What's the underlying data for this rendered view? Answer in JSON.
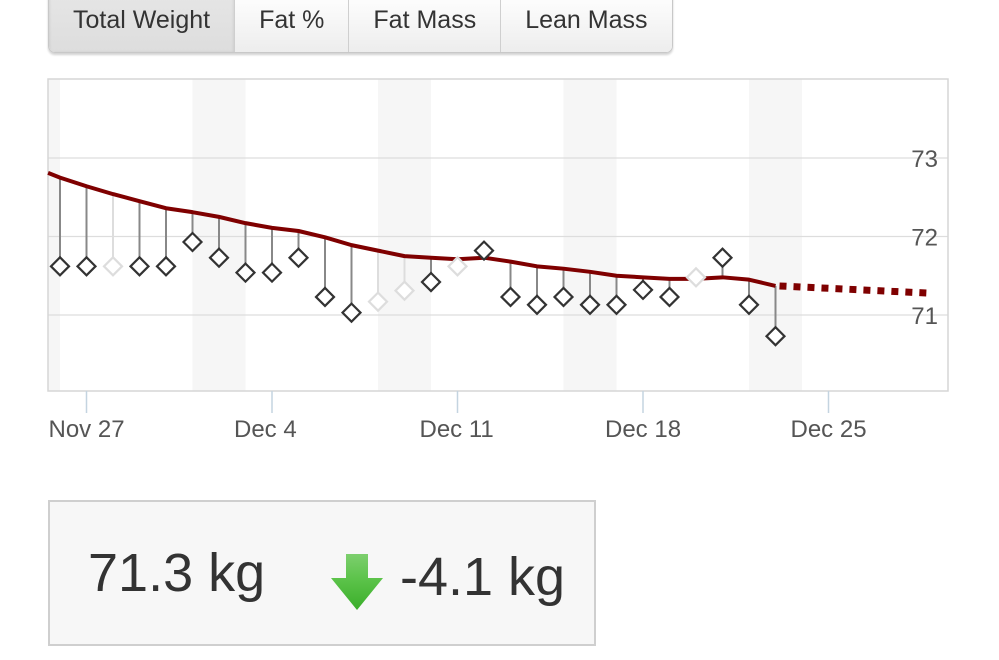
{
  "tabs": [
    {
      "label": "Total Weight",
      "active": true
    },
    {
      "label": "Fat %",
      "active": false
    },
    {
      "label": "Fat Mass",
      "active": false
    },
    {
      "label": "Lean Mass",
      "active": false
    }
  ],
  "summary": {
    "current_weight": "71.3 kg",
    "change_icon": "down-arrow-icon",
    "change": "-4.1 kg",
    "change_color": "#4cbb3a"
  },
  "colors": {
    "trend": "#7f0000",
    "stem": "#888888",
    "stem_faded": "#dddddd",
    "marker": "#333333",
    "marker_faded": "#dddddd",
    "grid": "#dddddd",
    "weekend_band": "#f6f6f6",
    "axis_text": "#555555"
  },
  "chart_data": {
    "type": "line",
    "title": "",
    "xlabel": "",
    "ylabel": "",
    "x_start": "Nov 25",
    "x_end": "Dec 29",
    "ylim": [
      70.0,
      74.0
    ],
    "y_ticks": [
      71,
      72,
      73
    ],
    "y_tick_labels": [
      "71",
      "72",
      "73"
    ],
    "y_axis_side": "right",
    "x_tick_days": [
      2,
      9,
      16,
      23,
      30
    ],
    "x_tick_labels": [
      "Nov 27",
      "Dec 4",
      "Dec 11",
      "Dec 18",
      "Dec 25"
    ],
    "weekend_bands_days": [
      [
        0,
        1
      ],
      [
        6,
        8
      ],
      [
        13,
        15
      ],
      [
        20,
        22
      ],
      [
        27,
        29
      ]
    ],
    "grid": true,
    "legend": "none",
    "series": [
      {
        "name": "Weight",
        "style": "diamond-markers-with-stems",
        "days": [
          1,
          2,
          3,
          4,
          5,
          6,
          7,
          8,
          9,
          10,
          11,
          12,
          13,
          14,
          15,
          16,
          17,
          18,
          19,
          20,
          21,
          22,
          23,
          24,
          25,
          26,
          27,
          28
        ],
        "dates": [
          "Nov 26",
          "Nov 27",
          "Nov 28",
          "Nov 29",
          "Nov 30",
          "Dec 1",
          "Dec 2",
          "Dec 3",
          "Dec 4",
          "Dec 5",
          "Dec 6",
          "Dec 7",
          "Dec 8",
          "Dec 9",
          "Dec 10",
          "Dec 11",
          "Dec 12",
          "Dec 13",
          "Dec 14",
          "Dec 15",
          "Dec 16",
          "Dec 17",
          "Dec 18",
          "Dec 19",
          "Dec 20",
          "Dec 21",
          "Dec 22",
          "Dec 23"
        ],
        "values": [
          71.62,
          71.62,
          71.62,
          71.62,
          71.62,
          71.93,
          71.73,
          71.54,
          71.54,
          71.73,
          71.23,
          71.03,
          71.17,
          71.31,
          71.42,
          71.62,
          71.82,
          71.23,
          71.13,
          71.23,
          71.13,
          71.13,
          71.32,
          71.23,
          71.48,
          71.73,
          71.13,
          70.73
        ],
        "faded": [
          false,
          false,
          true,
          false,
          false,
          false,
          false,
          false,
          false,
          false,
          false,
          false,
          true,
          true,
          false,
          true,
          false,
          false,
          false,
          false,
          false,
          false,
          false,
          false,
          true,
          false,
          false,
          false
        ]
      },
      {
        "name": "Trend",
        "style": "solid",
        "days": [
          0.55,
          1,
          2,
          3,
          4,
          5,
          6,
          7,
          8,
          9,
          10,
          11,
          12,
          13,
          14,
          15,
          16,
          17,
          18,
          19,
          20,
          21,
          22,
          23,
          24,
          25,
          26,
          27,
          28
        ],
        "values": [
          72.81,
          72.75,
          72.64,
          72.54,
          72.45,
          72.36,
          72.31,
          72.25,
          72.17,
          72.11,
          72.07,
          71.99,
          71.89,
          71.82,
          71.75,
          71.73,
          71.71,
          71.73,
          71.68,
          71.62,
          71.59,
          71.55,
          71.5,
          71.48,
          71.46,
          71.46,
          71.48,
          71.45,
          71.37
        ]
      },
      {
        "name": "Forecast",
        "style": "dotted",
        "days": [
          28,
          33.7
        ],
        "values": [
          71.37,
          71.28
        ]
      }
    ]
  }
}
